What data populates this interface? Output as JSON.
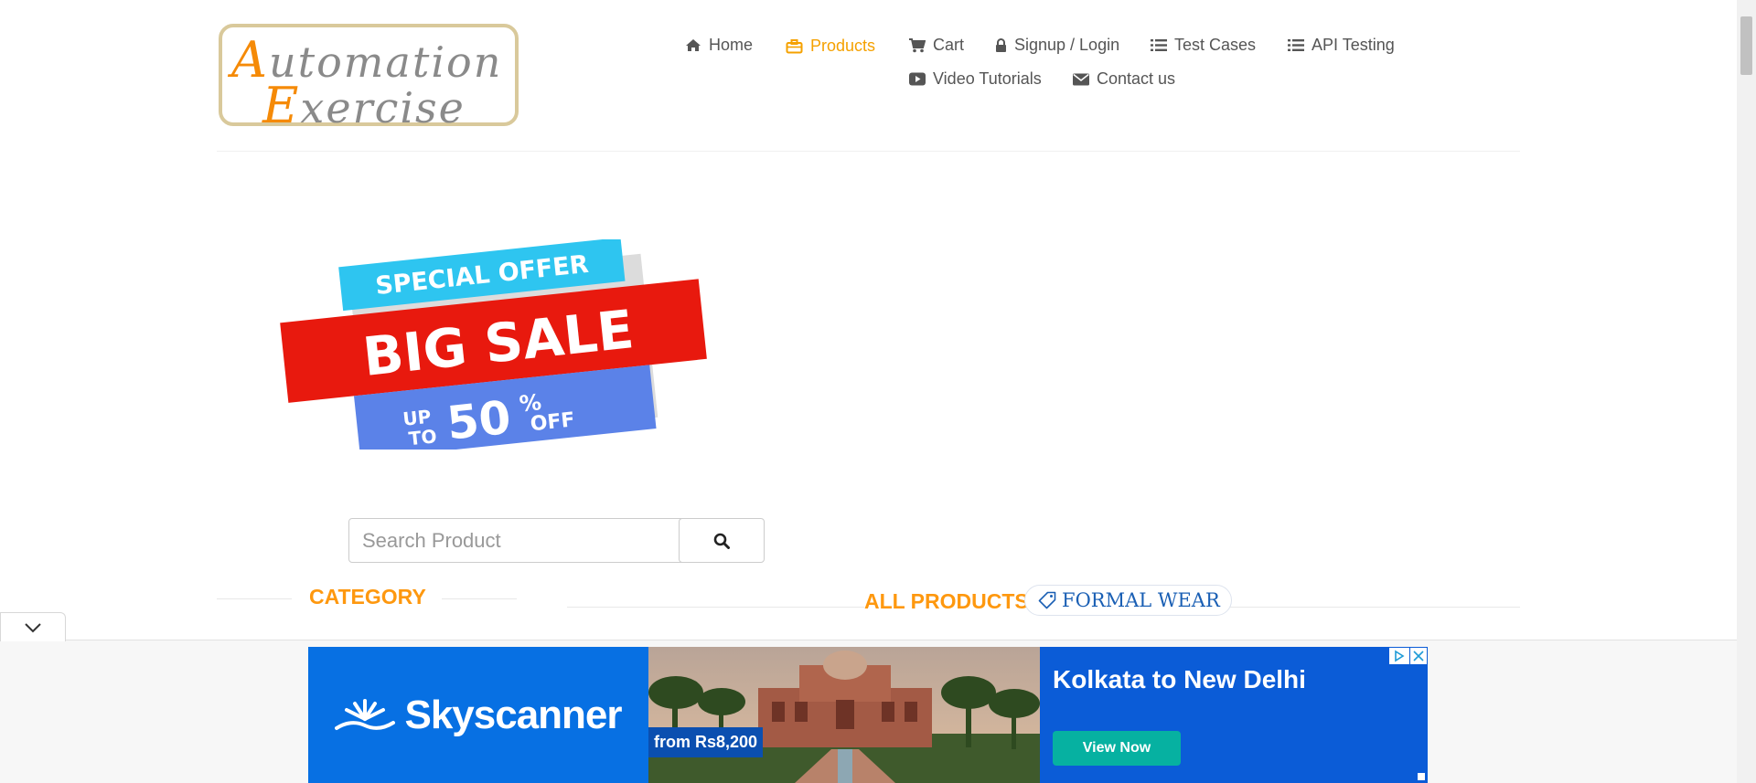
{
  "logo": {
    "line1_cap": "A",
    "line1_rest": "utomation",
    "line2_cap": "E",
    "line2_rest": "xercise"
  },
  "nav": {
    "home": {
      "label": "Home",
      "icon": "home-icon"
    },
    "products": {
      "label": "Products",
      "icon": "briefcase-icon",
      "active": true
    },
    "cart": {
      "label": "Cart",
      "icon": "cart-icon"
    },
    "signup": {
      "label": "Signup / Login",
      "icon": "lock-icon"
    },
    "test_cases": {
      "label": "Test Cases",
      "icon": "list-icon"
    },
    "api_testing": {
      "label": "API Testing",
      "icon": "list-icon"
    },
    "video": {
      "label": "Video Tutorials",
      "icon": "youtube-play-icon"
    },
    "contact": {
      "label": "Contact us",
      "icon": "envelope-icon"
    }
  },
  "banner": {
    "line1": "SPECIAL OFFER",
    "line2": "BIG SALE",
    "up": "UP",
    "to": "TO",
    "percent": "50",
    "pct_sign": "%",
    "off": "OFF"
  },
  "search": {
    "placeholder": "Search Product",
    "value": "",
    "button_icon": "search-icon"
  },
  "sidebar": {
    "category_title": "CATEGORY"
  },
  "main": {
    "products_title": "ALL PRODUCTS",
    "tag_label": "FORMAL WEAR",
    "tag_icon": "tag-icon"
  },
  "ad": {
    "brand": "Skyscanner",
    "price": "from Rs8,200",
    "headline": "Kolkata to New Delhi",
    "cta": "View Now"
  },
  "colors": {
    "accent": "#fe980f",
    "ad_blue": "#0b5cd7",
    "cta_teal": "#06b1a1"
  }
}
